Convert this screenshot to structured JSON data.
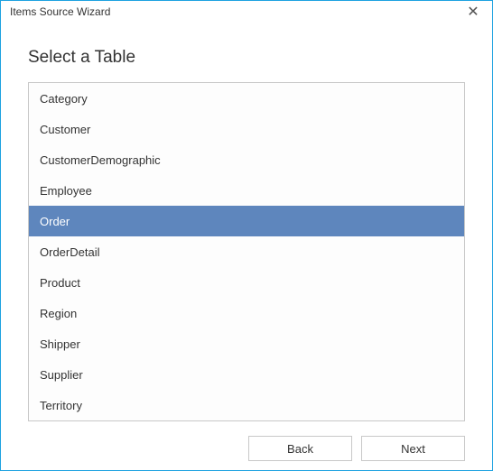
{
  "titlebar": {
    "title": "Items Source Wizard",
    "close_icon": "✕"
  },
  "heading": "Select a Table",
  "tables": [
    {
      "label": "Category",
      "selected": false
    },
    {
      "label": "Customer",
      "selected": false
    },
    {
      "label": "CustomerDemographic",
      "selected": false
    },
    {
      "label": "Employee",
      "selected": false
    },
    {
      "label": "Order",
      "selected": true
    },
    {
      "label": "OrderDetail",
      "selected": false
    },
    {
      "label": "Product",
      "selected": false
    },
    {
      "label": "Region",
      "selected": false
    },
    {
      "label": "Shipper",
      "selected": false
    },
    {
      "label": "Supplier",
      "selected": false
    },
    {
      "label": "Territory",
      "selected": false
    }
  ],
  "buttons": {
    "back": "Back",
    "next": "Next"
  }
}
